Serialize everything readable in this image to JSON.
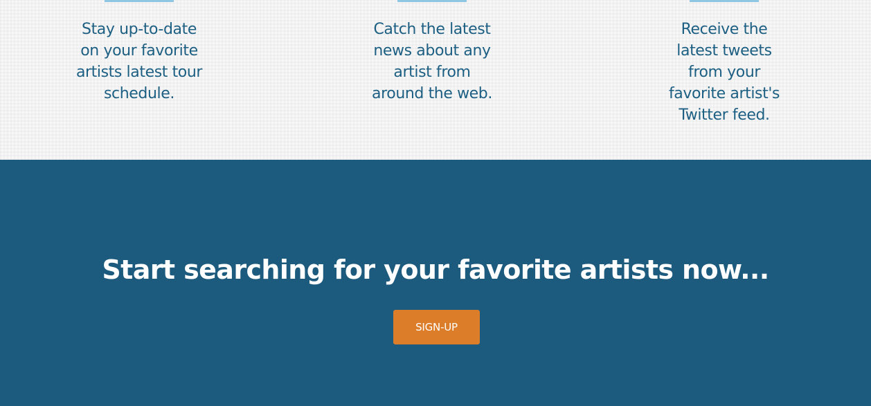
{
  "features": [
    {
      "lines": [
        "Stay up-to-date",
        "on your favorite",
        "artists latest tour",
        "schedule."
      ]
    },
    {
      "lines": [
        "Catch the latest",
        "news about any",
        "artist from",
        "around the web."
      ]
    },
    {
      "lines": [
        "Receive the",
        "latest tweets",
        "from your",
        "favorite artist's",
        "Twitter feed."
      ]
    }
  ],
  "cta": {
    "heading": "Start searching for your favorite artists now...",
    "button_label": "SIGN-UP"
  },
  "colors": {
    "feature_text": "#1c5f83",
    "accent_bar": "#8fc6e3",
    "cta_background": "#1c5a7e",
    "button_background": "#dc7d2a",
    "cta_text": "#ffffff"
  }
}
